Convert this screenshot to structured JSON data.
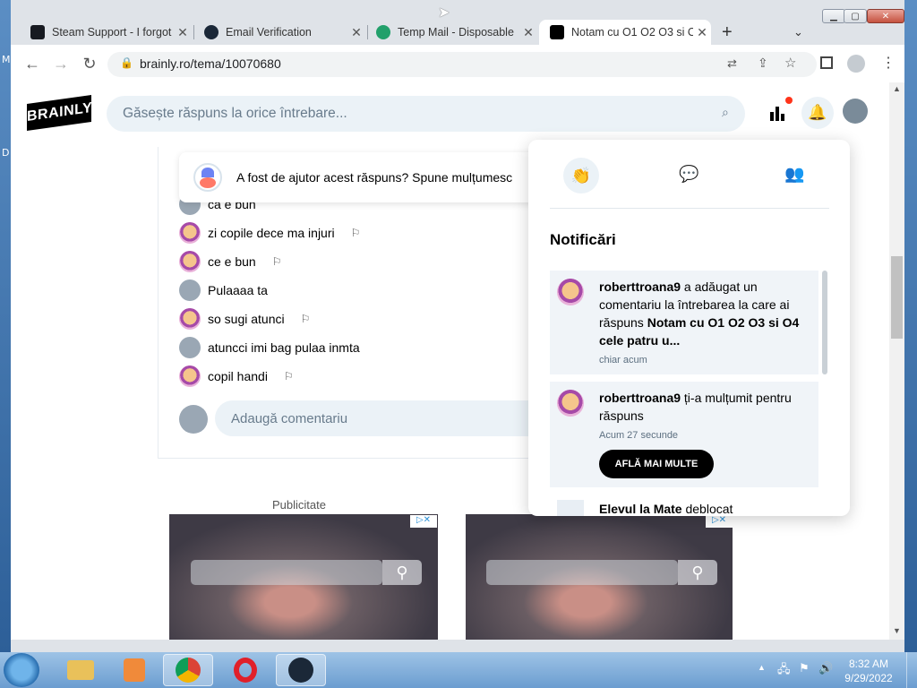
{
  "desktop": {
    "left_labels": [
      "M",
      "D"
    ]
  },
  "browser": {
    "tabs": [
      {
        "title": "Steam Support - I forgot",
        "icon": "steam-icon",
        "active": false
      },
      {
        "title": "Email Verification",
        "icon": "steam-icon",
        "active": false
      },
      {
        "title": "Temp Mail - Disposable",
        "icon": "tempmail-icon",
        "active": false
      },
      {
        "title": "Notam cu O1 O2 O3 si O",
        "icon": "brainly-icon",
        "active": true
      }
    ],
    "new_tab": "+",
    "url": "brainly.ro/tema/10070680"
  },
  "brainly": {
    "logo": "BRAINLY",
    "search_placeholder": "Găsește răspuns la orice întrebare...",
    "helpful_prompt": "A fost de ajutor acest răspuns? Spune mulțumesc",
    "comments": [
      {
        "text": "ca e bun",
        "avatar": "gray",
        "flag": false
      },
      {
        "text": "zi copile dece ma injuri",
        "avatar": "img",
        "flag": true
      },
      {
        "text": "ce e bun",
        "avatar": "img",
        "flag": true
      },
      {
        "text": "Pulaaaa ta",
        "avatar": "gray",
        "flag": false
      },
      {
        "text": "so sugi atunci",
        "avatar": "img",
        "flag": true
      },
      {
        "text": "atuncci imi bag pulaa inmta",
        "avatar": "gray",
        "flag": false
      },
      {
        "text": "copil handi",
        "avatar": "img",
        "flag": true
      }
    ],
    "comment_placeholder": "Adaugă comentariu",
    "ad_label": "Publicitate"
  },
  "notifications": {
    "title": "Notificări",
    "items": [
      {
        "user": "roberttroana9",
        "text1": " a adăugat un comentariu la întrebarea la care ai răspuns ",
        "bold": "Notam cu O1 O2 O3 si O4 cele patru u...",
        "time": "chiar acum"
      },
      {
        "user": "roberttroana9",
        "text1": " ți-a mulțumit pentru răspuns",
        "bold": "",
        "time": "Acum 27 secunde",
        "button": "AFLĂ MAI MULTE"
      },
      {
        "user": "Elevul la Mate",
        "text1": " deblocat",
        "bold": "",
        "time": ""
      }
    ]
  },
  "taskbar": {
    "apps": [
      "explorer-icon",
      "media-player-icon",
      "chrome-icon",
      "opera-icon",
      "steam-icon"
    ],
    "time": "8:32 AM",
    "date": "9/29/2022"
  },
  "colors": {
    "accent_blue": "#4fb3f6",
    "brainly_black": "#000000",
    "notif_bg": "#f0f4f8",
    "badge_red": "#ff341a"
  }
}
